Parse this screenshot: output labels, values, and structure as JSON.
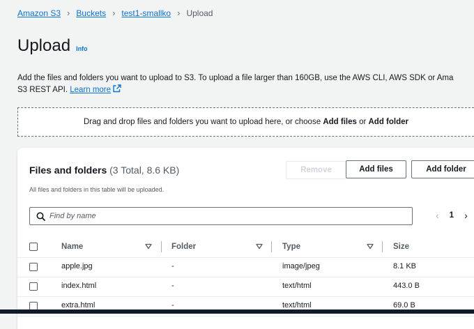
{
  "breadcrumb": {
    "items": [
      "Amazon S3",
      "Buckets",
      "test1-smallko"
    ],
    "current": "Upload"
  },
  "page": {
    "title": "Upload",
    "info": "Info",
    "description_line1": "Add the files and folders you want to upload to S3. To upload a file larger than 160GB, use the AWS CLI, AWS SDK or Ama",
    "description_line2": "S3 REST API.",
    "learn_more": "Learn more"
  },
  "dropzone": {
    "text_prefix": "Drag and drop files and folders you want to upload here, or choose ",
    "add_files": "Add files",
    "or": " or ",
    "add_folder": "Add folder"
  },
  "files": {
    "title": "Files and folders",
    "count": "(3 Total, 8.6 KB)",
    "subtitle": "All files and folders in this table will be uploaded.",
    "remove_label": "Remove",
    "add_files_label": "Add files",
    "add_folder_label": "Add folder",
    "search_placeholder": "Find by name",
    "page_number": "1",
    "columns": [
      "Name",
      "Folder",
      "Type",
      "Size"
    ],
    "rows": [
      {
        "name": "apple.jpg",
        "folder": "-",
        "type": "image/jpeg",
        "size": "8.1 KB"
      },
      {
        "name": "index.html",
        "folder": "-",
        "type": "text/html",
        "size": "443.0 B"
      },
      {
        "name": "extra.html",
        "folder": "-",
        "type": "text/html",
        "size": "69.0 B"
      }
    ]
  },
  "colors": {
    "link": "#0972d3",
    "background": "#f2f3f3",
    "text": "#16191f",
    "muted": "#545b64"
  },
  "icons": {
    "breadcrumb_separator": "chevron-right-icon",
    "external_link": "external-link-icon",
    "search": "search-icon",
    "sort": "caret-down-icon",
    "pager_prev": "chevron-left-icon",
    "pager_next": "chevron-right-icon"
  }
}
